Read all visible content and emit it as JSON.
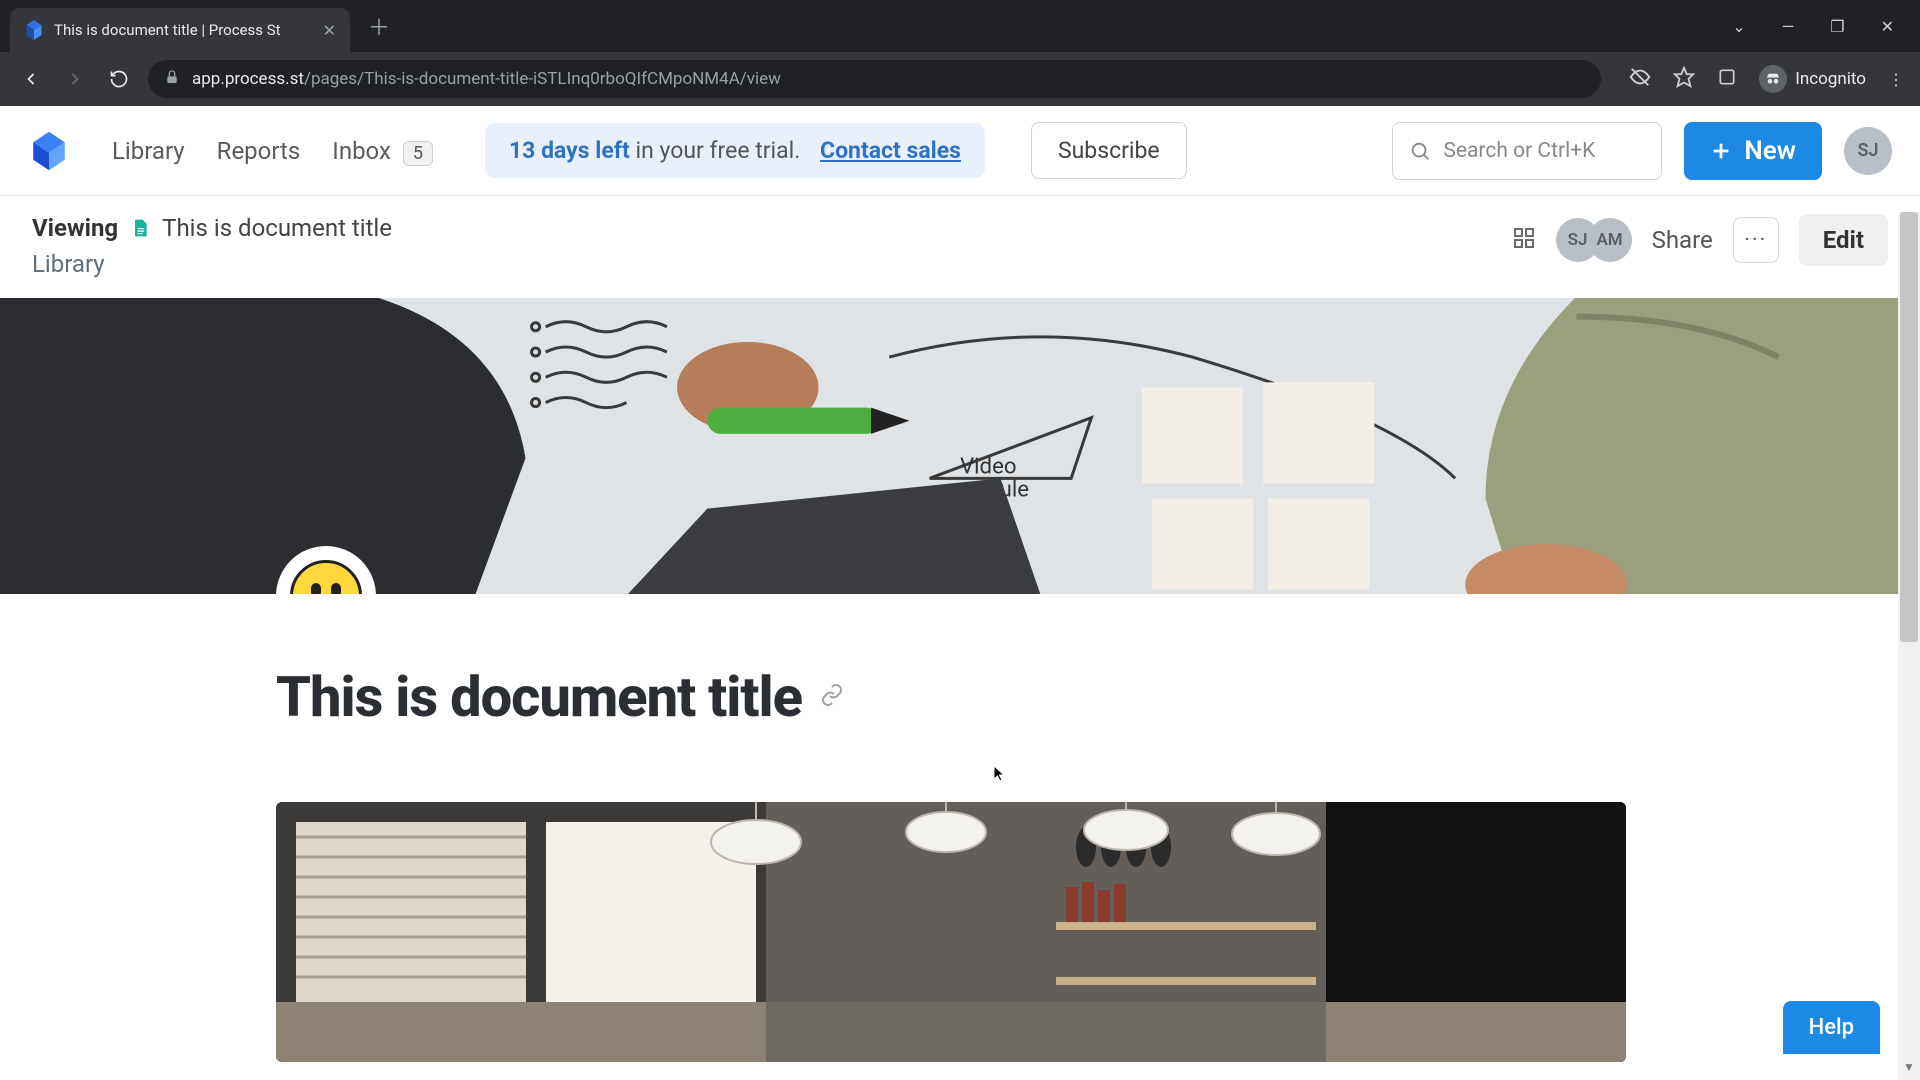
{
  "browser": {
    "tab_title": "This is document title | Process St",
    "url_host": "app.process.st",
    "url_path": "/pages/This-is-document-title-iSTLInq0rboQIfCMpoNM4A/view",
    "incognito_label": "Incognito"
  },
  "app": {
    "nav": {
      "library": "Library",
      "reports": "Reports",
      "inbox": "Inbox",
      "inbox_count": "5"
    },
    "trial": {
      "days_left": "13 days left",
      "tail": " in your free trial.",
      "contact": "Contact sales"
    },
    "subscribe_label": "Subscribe",
    "search_placeholder": "Search or Ctrl+K",
    "new_label": "New",
    "user_initials": "SJ"
  },
  "page": {
    "viewing_label": "Viewing",
    "doc_title_crumb": "This is document title",
    "library_crumb": "Library",
    "collab1": "SJ",
    "collab2": "AM",
    "share_label": "Share",
    "more_label": "···",
    "edit_label": "Edit",
    "doc_title": "This is document title",
    "emoji_icon": "grinning-face"
  },
  "help": {
    "label": "Help"
  },
  "colors": {
    "accent": "#1e88e5",
    "trial_bg": "#e8f1fb"
  }
}
